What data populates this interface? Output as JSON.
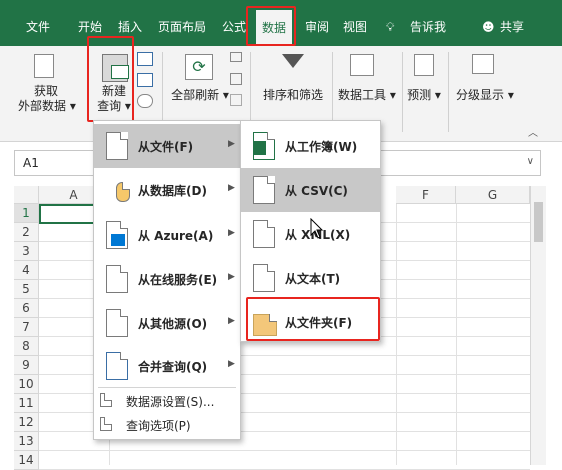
{
  "ribbon_tabs": [
    "文件",
    "开始",
    "插入",
    "页面布局",
    "公式",
    "数据",
    "审阅",
    "视图",
    "告诉我",
    "共享"
  ],
  "ribbon": {
    "get_external": [
      "获取",
      "外部数据"
    ],
    "new_query": [
      "新建",
      "查询"
    ],
    "refresh_all": "全部刷新",
    "sort_filter": "排序和筛选",
    "data_tools": "数据工具",
    "forecast": "预测",
    "outline": "分级显示"
  },
  "name_box": "A1",
  "columns": [
    "A",
    "F",
    "G"
  ],
  "rows": [
    "1",
    "2",
    "3",
    "4",
    "5",
    "6",
    "7",
    "8",
    "9",
    "10",
    "11",
    "12",
    "13",
    "14"
  ],
  "menu_main": [
    {
      "label": "从文件(F)",
      "icon": "file-icon"
    },
    {
      "label": "从数据库(D)",
      "icon": "database-icon"
    },
    {
      "label": "从 Azure(A)",
      "icon": "azure-icon"
    },
    {
      "label": "从在线服务(E)",
      "icon": "online-service-icon"
    },
    {
      "label": "从其他源(O)",
      "icon": "other-source-icon"
    },
    {
      "label": "合并查询(Q)",
      "icon": "merge-query-icon"
    },
    {
      "label": "数据源设置(S)...",
      "icon": "data-source-settings-icon"
    },
    {
      "label": "查询选项(P)",
      "icon": "query-options-icon"
    }
  ],
  "menu_sub": [
    {
      "label": "从工作簿(W)",
      "icon": "excel-workbook-icon"
    },
    {
      "label": "从 CSV(C)",
      "icon": "csv-file-icon"
    },
    {
      "label": "从 XML(X)",
      "icon": "xml-file-icon"
    },
    {
      "label": "从文本(T)",
      "icon": "text-file-icon"
    },
    {
      "label": "从文件夹(F)",
      "icon": "folder-icon"
    }
  ],
  "colors": {
    "accent": "#217346",
    "highlight": "#e8251f",
    "menu_hover": "#c8c8c8"
  }
}
